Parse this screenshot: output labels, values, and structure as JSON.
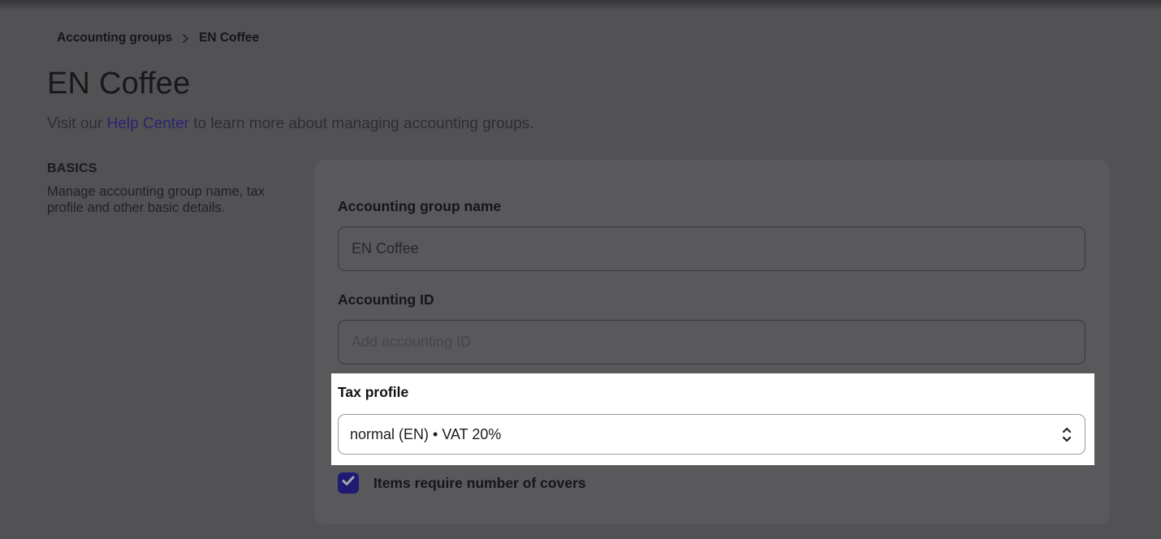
{
  "breadcrumb": {
    "parent": "Accounting groups",
    "current": "EN Coffee",
    "separator_icon": "chevron-right"
  },
  "page": {
    "title": "EN Coffee",
    "subtitle_prefix": "Visit our ",
    "subtitle_link": "Help Center",
    "subtitle_suffix": " to learn more about managing accounting groups."
  },
  "sidebar_section": {
    "heading": "BASICS",
    "description": "Manage accounting group name, tax profile and other basic details."
  },
  "form": {
    "name_label": "Accounting group name",
    "name_value": "EN Coffee",
    "id_label": "Accounting ID",
    "id_placeholder": "Add accounting ID",
    "tax_label": "Tax profile",
    "tax_selected_option": "normal (EN) • VAT 20%",
    "covers_label": "Items require number of covers",
    "covers_checked": true
  },
  "icons": {
    "select": "chevron-up-down",
    "checkbox": "check"
  },
  "colors": {
    "link_purple": "#2b2472",
    "checkbox_purple": "#201a73",
    "spotlight": "#ffffff",
    "dimmed_background": "#525254",
    "dimmed_card": "#59595b"
  }
}
